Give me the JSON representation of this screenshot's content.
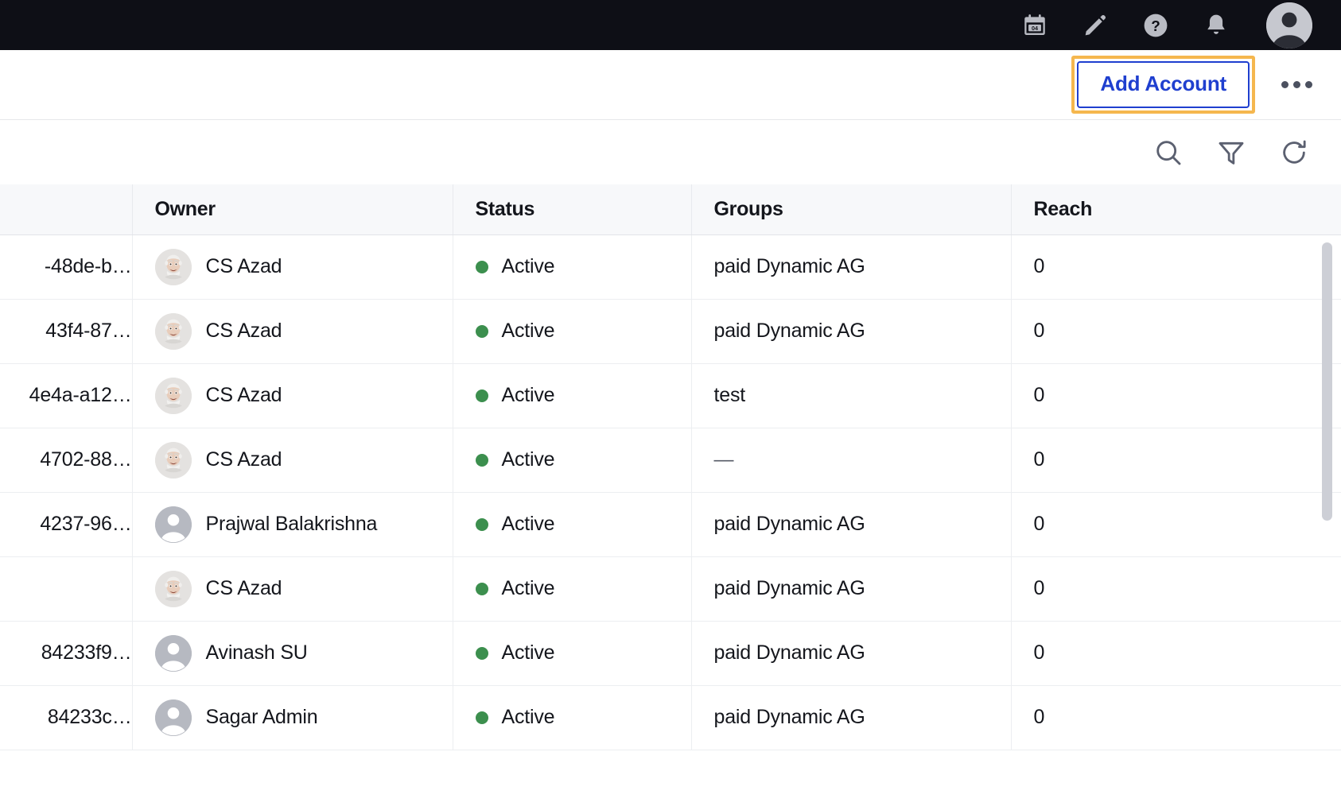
{
  "topbar": {
    "icons": [
      {
        "name": "calendar-icon",
        "label": "04"
      },
      {
        "name": "edit-pencil-icon",
        "label": ""
      },
      {
        "name": "help-icon",
        "label": "?"
      },
      {
        "name": "notifications-bell-icon",
        "label": ""
      },
      {
        "name": "user-avatar-icon",
        "label": ""
      }
    ],
    "calendar_day": "04",
    "help_glyph": "?"
  },
  "actionbar": {
    "add_account_label": "Add Account",
    "more_options_label": "•••",
    "focus_color": "#f5b74e",
    "accent_color": "#1f3fcf"
  },
  "tabletools": {
    "search_label": "Search",
    "filter_label": "Filter",
    "refresh_label": "Refresh"
  },
  "table": {
    "columns": [
      {
        "key": "id",
        "label": ""
      },
      {
        "key": "owner",
        "label": "Owner"
      },
      {
        "key": "status",
        "label": "Status"
      },
      {
        "key": "groups",
        "label": "Groups"
      },
      {
        "key": "reach",
        "label": "Reach"
      }
    ],
    "status_color": "#3c8f4e",
    "rows": [
      {
        "id": "-48de-b…",
        "owner": "CS Azad",
        "avatar": "photo",
        "status": "Active",
        "groups": "paid Dynamic AG",
        "reach": "0"
      },
      {
        "id": "43f4-87…",
        "owner": "CS Azad",
        "avatar": "photo",
        "status": "Active",
        "groups": "paid Dynamic AG",
        "reach": "0"
      },
      {
        "id": "4e4a-a12…",
        "owner": "CS Azad",
        "avatar": "photo",
        "status": "Active",
        "groups": "test",
        "reach": "0"
      },
      {
        "id": "4702-88…",
        "owner": "CS Azad",
        "avatar": "photo",
        "status": "Active",
        "groups": "—",
        "reach": "0"
      },
      {
        "id": "4237-96…",
        "owner": "Prajwal Balakrishna",
        "avatar": "generic",
        "status": "Active",
        "groups": "paid Dynamic AG",
        "reach": "0"
      },
      {
        "id": "",
        "owner": "CS Azad",
        "avatar": "photo",
        "status": "Active",
        "groups": "paid Dynamic AG",
        "reach": "0"
      },
      {
        "id": "84233f9…",
        "owner": "Avinash SU",
        "avatar": "generic",
        "status": "Active",
        "groups": "paid Dynamic AG",
        "reach": "0"
      },
      {
        "id": "84233c…",
        "owner": "Sagar Admin",
        "avatar": "generic",
        "status": "Active",
        "groups": "paid Dynamic AG",
        "reach": "0"
      }
    ]
  }
}
